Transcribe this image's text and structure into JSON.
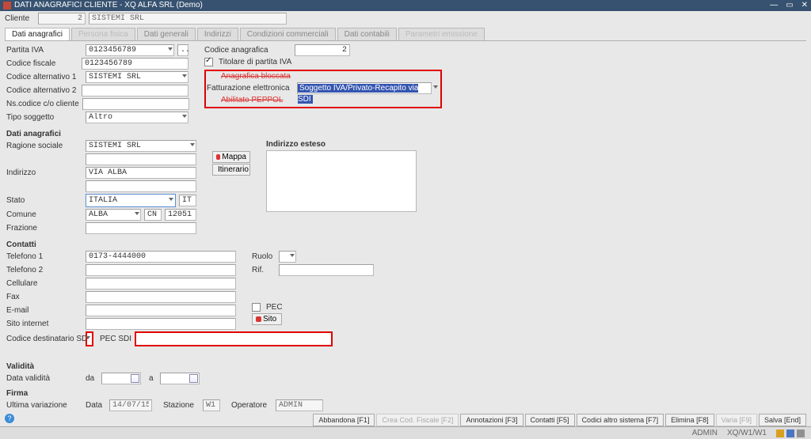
{
  "title": "DATI ANAGRAFICI CLIENTE - XQ ALFA SRL  (Demo)",
  "cliente": {
    "label": "Cliente",
    "code": "2",
    "name": "SISTEMI SRL"
  },
  "tabs": [
    {
      "label": "Dati anagrafici"
    },
    {
      "label": "Persona fisica"
    },
    {
      "label": "Dati generali"
    },
    {
      "label": "Indirizzi"
    },
    {
      "label": "Condizioni commerciali"
    },
    {
      "label": "Dati contabili"
    },
    {
      "label": "Parametri emissione"
    }
  ],
  "top_left": {
    "partita_iva": {
      "label": "Partita IVA",
      "value": "0123456789"
    },
    "codice_fiscale": {
      "label": "Codice fiscale",
      "value": "0123456789"
    },
    "cod_alt1": {
      "label": "Codice alternativo 1",
      "value": "SISTEMI SRL"
    },
    "cod_alt2": {
      "label": "Codice alternativo 2",
      "value": ""
    },
    "ns_codice": {
      "label": "Ns.codice c/o cliente",
      "value": ""
    },
    "tipo_soggetto": {
      "label": "Tipo soggetto",
      "value": "Altro"
    }
  },
  "top_right": {
    "codice_anagrafica": {
      "label": "Codice anagrafica",
      "value": "2"
    },
    "titolare": "Titolare di partita IVA",
    "anag_bloccata": "Anagrafica bloccata",
    "fatt_elettronica": {
      "label": "Fatturazione elettronica",
      "value": "Soggetto IVA/Privato-Recapito via SDI"
    },
    "abilitato_peppol": "Abilitato PEPPOL"
  },
  "anagrafici": {
    "title": "Dati anagrafici",
    "ragione": {
      "label": "Ragione sociale",
      "value": "SISTEMI SRL"
    },
    "indirizzo": {
      "label": "Indirizzo",
      "value": "VIA ALBA"
    },
    "stato": {
      "label": "Stato",
      "value": "ITALIA",
      "code": "IT"
    },
    "comune": {
      "label": "Comune",
      "value": "ALBA",
      "prov": "CN",
      "cap": "12051"
    },
    "frazione": {
      "label": "Frazione",
      "value": ""
    },
    "mappa": "Mappa",
    "itinerario": "Itinerario",
    "indirizzo_esteso": "Indirizzo esteso"
  },
  "contatti": {
    "title": "Contatti",
    "tel1": {
      "label": "Telefono 1",
      "value": "0173-4444000"
    },
    "tel2": {
      "label": "Telefono 2",
      "value": ""
    },
    "cell": {
      "label": "Cellulare",
      "value": ""
    },
    "fax": {
      "label": "Fax",
      "value": ""
    },
    "email": {
      "label": "E-mail",
      "value": ""
    },
    "sito": {
      "label": "Sito internet",
      "value": ""
    },
    "cod_dest_sdi": {
      "label": "Codice destinatario SDI",
      "value": ""
    },
    "pec_sdi": {
      "label": "PEC SDI",
      "value": ""
    },
    "ruolo": "Ruolo",
    "rif": "Rif.",
    "pec": "PEC",
    "sito_btn": "Sito"
  },
  "validita": {
    "title": "Validità",
    "data_validita": "Data validità",
    "da": "da",
    "a": "a"
  },
  "firma": {
    "title": "Firma",
    "ultima_variazione": "Ultima variazione",
    "data": "Data",
    "data_val": "14/07/15",
    "stazione": "Stazione",
    "stazione_val": "W1",
    "operatore": "Operatore",
    "operatore_val": "ADMIN"
  },
  "footer": [
    "Abbandona [F1]",
    "Crea Cod. Fiscale [F2]",
    "Annotazioni [F3]",
    "Contatti [F5]",
    "Codici altro sistema [F7]",
    "Elimina [F8]",
    "Varia [F9]",
    "Salva [End]"
  ],
  "status": {
    "user": "ADMIN",
    "context": "XQ/W1/W1"
  }
}
